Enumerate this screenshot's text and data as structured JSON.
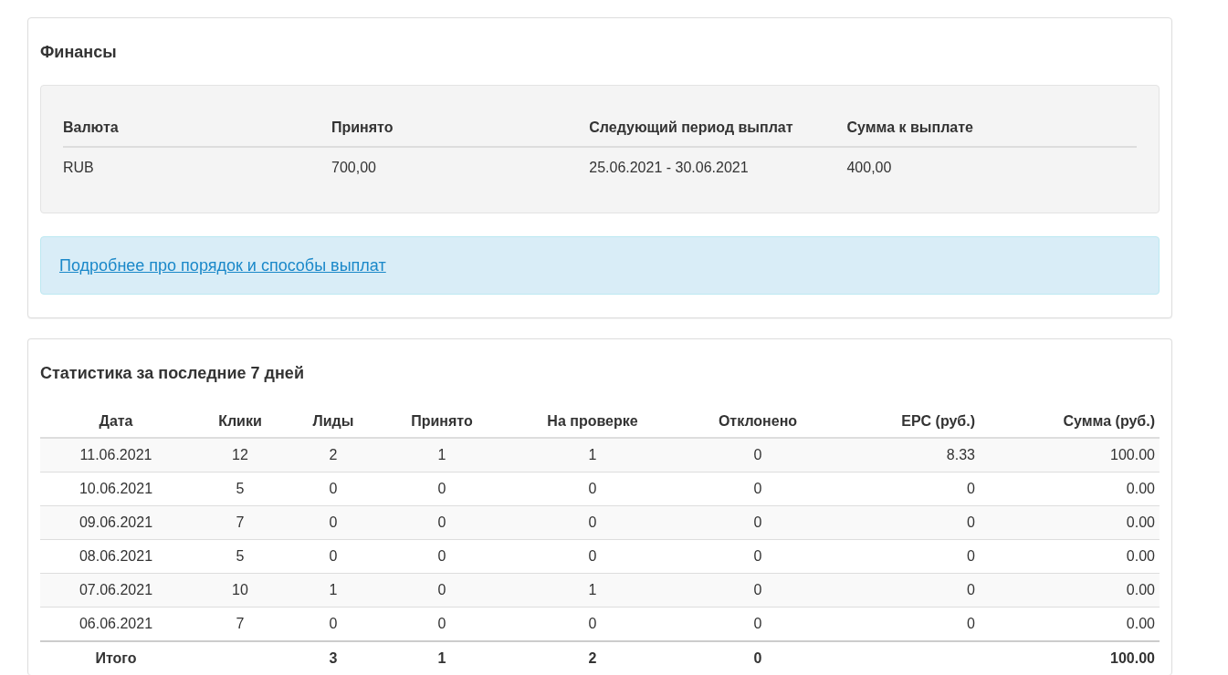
{
  "finance": {
    "title": "Финансы",
    "columns": [
      "Валюта",
      "Принято",
      "Следующий период выплат",
      "Сумма к выплате"
    ],
    "rows": [
      [
        "RUB",
        "700,00",
        "25.06.2021 - 30.06.2021",
        "400,00"
      ]
    ],
    "info_link": "Подробнее про порядок и способы выплат"
  },
  "stats": {
    "title": "Статистика за последние 7 дней",
    "columns": [
      "Дата",
      "Клики",
      "Лиды",
      "Принято",
      "На проверке",
      "Отклонено",
      "EPC (руб.)",
      "Сумма (руб.)"
    ],
    "rows": [
      [
        "11.06.2021",
        "12",
        "2",
        "1",
        "1",
        "0",
        "8.33",
        "100.00"
      ],
      [
        "10.06.2021",
        "5",
        "0",
        "0",
        "0",
        "0",
        "0",
        "0.00"
      ],
      [
        "09.06.2021",
        "7",
        "0",
        "0",
        "0",
        "0",
        "0",
        "0.00"
      ],
      [
        "08.06.2021",
        "5",
        "0",
        "0",
        "0",
        "0",
        "0",
        "0.00"
      ],
      [
        "07.06.2021",
        "10",
        "1",
        "0",
        "1",
        "0",
        "0",
        "0.00"
      ],
      [
        "06.06.2021",
        "7",
        "0",
        "0",
        "0",
        "0",
        "0",
        "0.00"
      ]
    ],
    "totals": {
      "label": "Итого",
      "leads": "3",
      "accepted": "1",
      "pending": "2",
      "rejected": "0",
      "sum": "100.00"
    }
  }
}
